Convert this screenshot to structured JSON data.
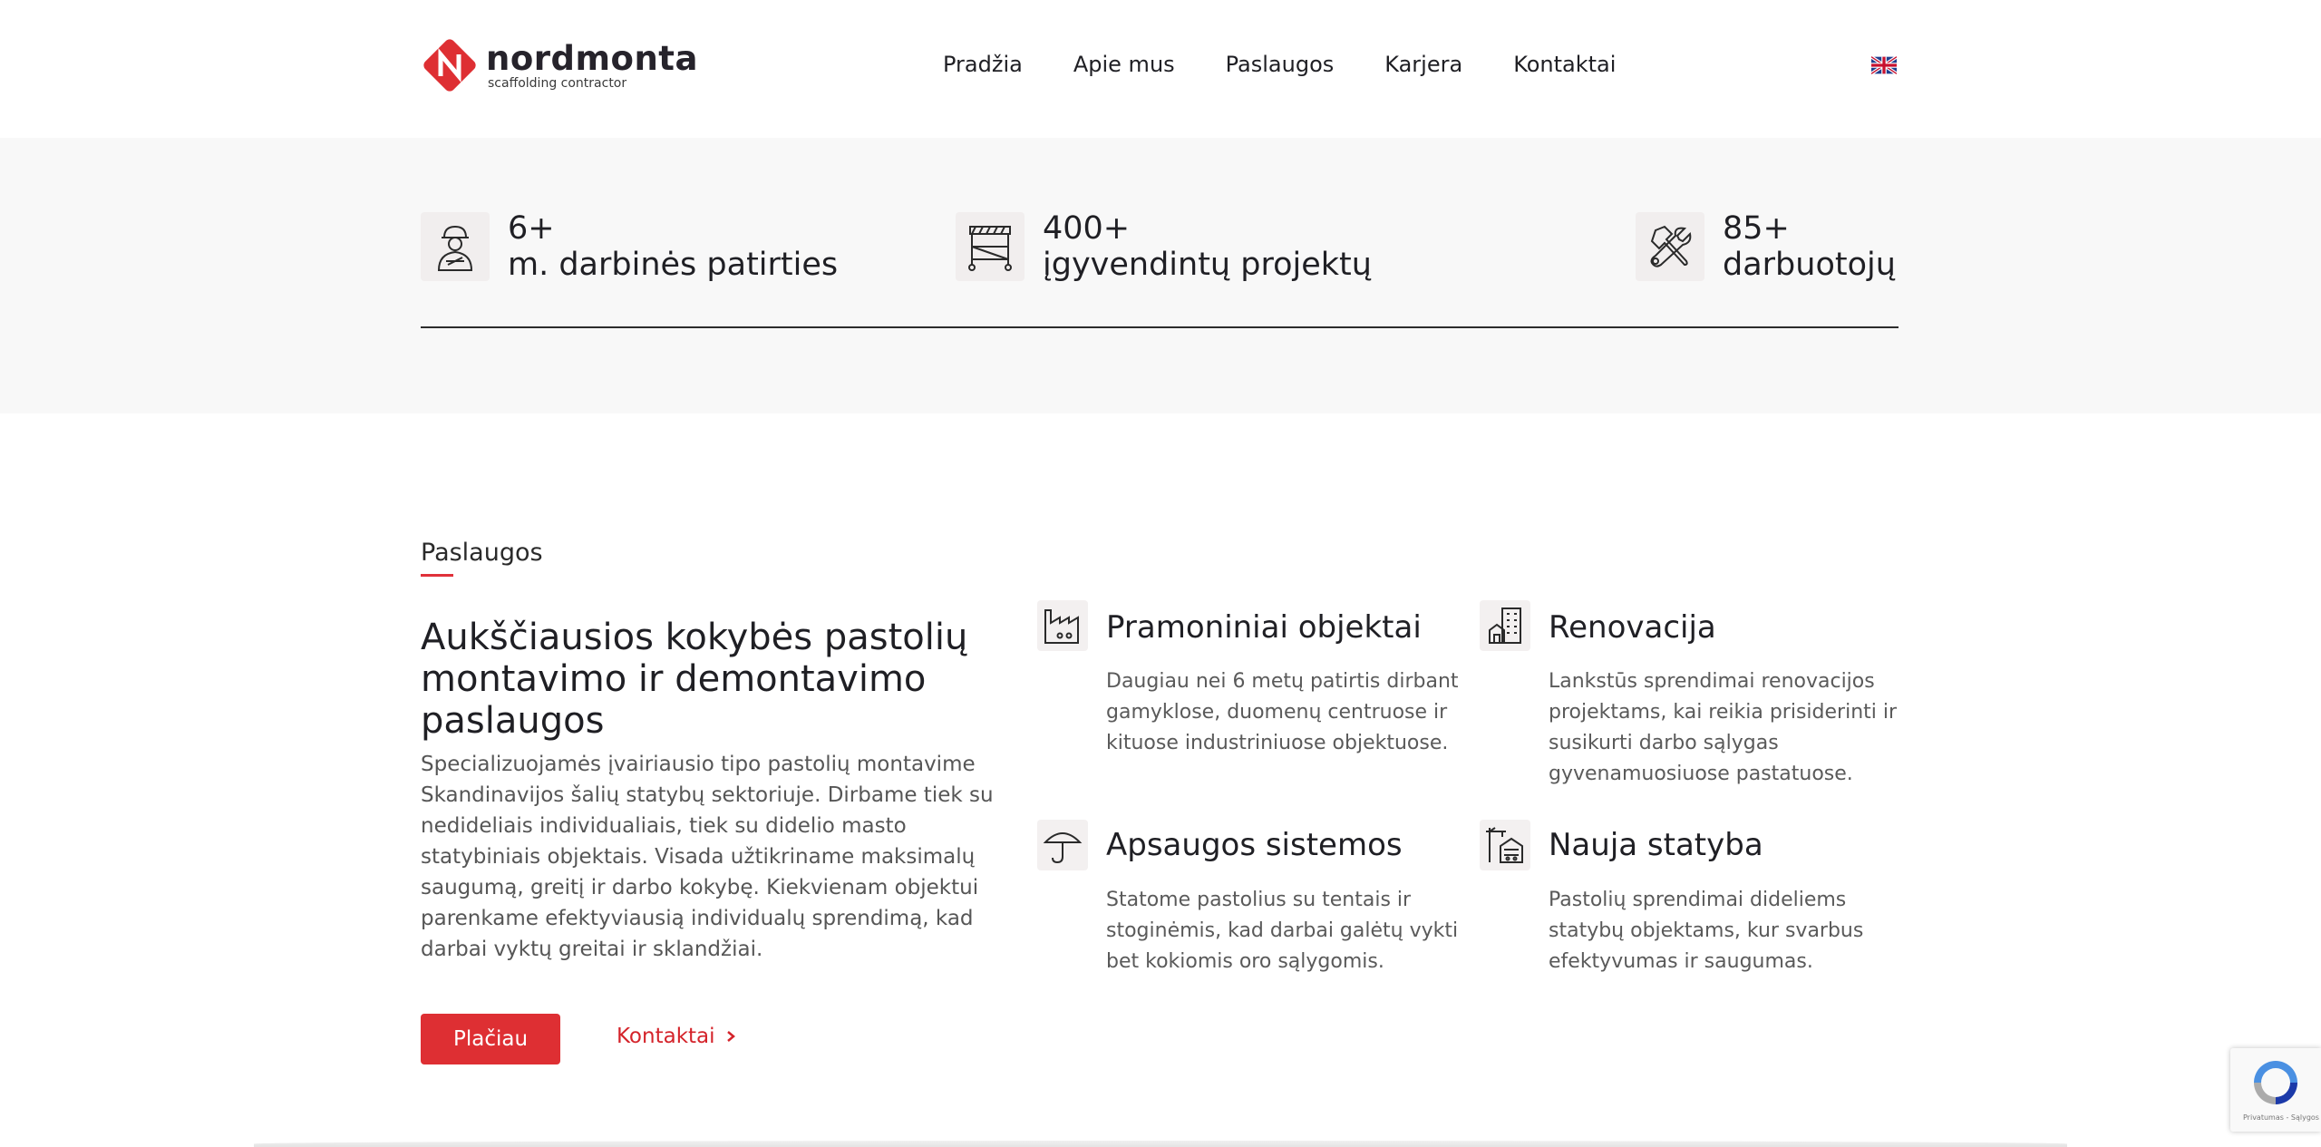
{
  "header": {
    "logo_name": "nordmonta",
    "logo_tagline": "scaffolding contractor",
    "nav": [
      "Pradžia",
      "Apie mus",
      "Paslaugos",
      "Karjera",
      "Kontaktai"
    ],
    "language_icon": "uk-flag-icon"
  },
  "stats": [
    {
      "value": "6+",
      "label": "m. darbinės patirties",
      "icon": "worker-icon"
    },
    {
      "value": "400+",
      "label": "įgyvendintų projektų",
      "icon": "scaffold-icon"
    },
    {
      "value": "85+",
      "label": "darbuotojų",
      "icon": "tools-icon"
    }
  ],
  "services": {
    "section_label": "Paslaugos",
    "heading": "Aukščiausios kokybės pastolių montavimo ir demontavimo paslaugos",
    "intro": "Specializuojamės įvairiausio tipo pastolių montavime Skandinavijos šalių statybų sektoriuje. Dirbame tiek su nedideliais individualiais, tiek su didelio masto statybiniais objektais. Visada užtikriname maksimalų saugumą, greitį ir darbo kokybę. Kiekvienam objektui parenkame efektyviausią individualų sprendimą, kad darbai vyktų greitai ir sklandžiai.",
    "primary_button": "Plačiau",
    "secondary_link": "Kontaktai",
    "items": [
      {
        "title": "Pramoniniai objektai",
        "desc": "Daugiau nei 6 metų patirtis dirbant gamyklose, duomenų centruose ir kituose industriniuose objektuose.",
        "icon": "factory-icon"
      },
      {
        "title": "Renovacija",
        "desc": "Lankstūs sprendimai renovacijos projektams, kai reikia prisiderinti ir susikurti darbo sąlygas gyvenamuosiuose pastatuose.",
        "icon": "buildings-icon"
      },
      {
        "title": "Apsaugos sistemos",
        "desc": "Statome pastolius su tentais ir stoginėmis, kad darbai galėtų vykti bet kokiomis oro sąlygomis.",
        "icon": "umbrella-icon"
      },
      {
        "title": "Nauja statyba",
        "desc": "Pastolių sprendimai dideliems statybų objektams, kur svarbus efektyvumas ir saugumas.",
        "icon": "crane-building-icon"
      }
    ]
  },
  "recaptcha": {
    "text": "Privatumas - Sąlygos"
  },
  "colors": {
    "brand_red": "#de2f33",
    "text_dark": "#1f1f24",
    "band_gray": "#f8f8f8"
  }
}
